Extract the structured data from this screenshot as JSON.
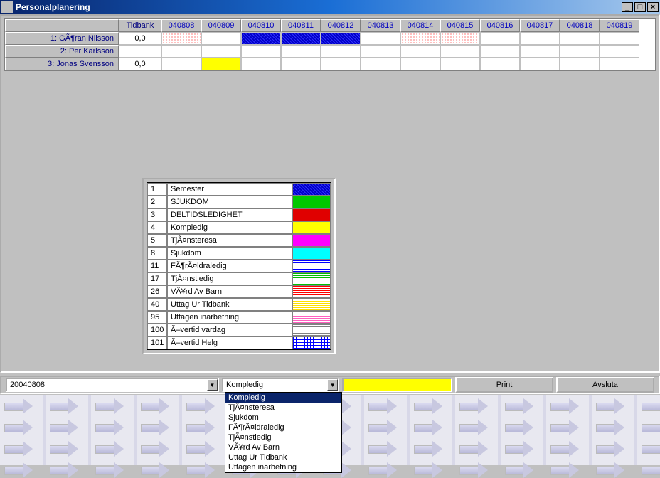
{
  "window": {
    "title": "Personalplanering"
  },
  "grid": {
    "headers": {
      "tidbank": "Tidbank",
      "dates": [
        "040808",
        "040809",
        "040810",
        "040811",
        "040812",
        "040813",
        "040814",
        "040815",
        "040816",
        "040817",
        "040818",
        "040819"
      ]
    },
    "rows": [
      {
        "name": "1: GÃ¶ran Nilsson",
        "tid": "0,0",
        "cells": [
          "pat-dotred",
          "",
          "pat-blue",
          "pat-blue",
          "pat-blue",
          "",
          "pat-dotred",
          "pat-dotred",
          "",
          "",
          "",
          ""
        ]
      },
      {
        "name": "2: Per Karlsson",
        "tid": "",
        "cells": [
          "",
          "",
          "",
          "",
          "",
          "",
          "",
          "",
          "",
          "",
          "",
          ""
        ]
      },
      {
        "name": "3: Jonas Svensson",
        "tid": "0,0",
        "cells": [
          "",
          "pat-yellow",
          "",
          "",
          "",
          "",
          "",
          "",
          "",
          "",
          "",
          ""
        ]
      }
    ]
  },
  "legend": [
    {
      "num": "1",
      "name": "Semester",
      "sw": "pat-blue"
    },
    {
      "num": "2",
      "name": "SJUKDOM",
      "sw": "pat-green"
    },
    {
      "num": "3",
      "name": "DELTIDSLEDIGHET",
      "sw": "pat-red"
    },
    {
      "num": "4",
      "name": "Kompledig",
      "sw": "pat-yellow"
    },
    {
      "num": "5",
      "name": "TjÃ¤nsteresa",
      "sw": "pat-magenta"
    },
    {
      "num": "8",
      "name": "Sjukdom",
      "sw": "pat-cyan"
    },
    {
      "num": "11",
      "name": "FÃ¶rÃ¤ldraledig",
      "sw": "pat-stripe-blue"
    },
    {
      "num": "17",
      "name": "TjÃ¤nstledig",
      "sw": "pat-stripe-green"
    },
    {
      "num": "26",
      "name": "VÃ¥rd Av Barn",
      "sw": "pat-stripe-red"
    },
    {
      "num": "40",
      "name": "Uttag Ur Tidbank",
      "sw": "pat-stripe-yellow"
    },
    {
      "num": "95",
      "name": "Uttagen inarbetning",
      "sw": "pat-stripe-pink"
    },
    {
      "num": "100",
      "name": "Ã–vertid vardag",
      "sw": "pat-stripe-gray"
    },
    {
      "num": "101",
      "name": "Ã–vertid Helg",
      "sw": "pat-grid-blue"
    }
  ],
  "bottom": {
    "date": "20040808",
    "type_selected": "Kompledig",
    "swatch": "pat-yellow",
    "print": "Print",
    "close": "Avsluta"
  },
  "dropdown": [
    {
      "label": "Kompledig",
      "selected": true
    },
    {
      "label": "TjÃ¤nsteresa"
    },
    {
      "label": "Sjukdom"
    },
    {
      "label": "FÃ¶rÃ¤ldraledig"
    },
    {
      "label": "TjÃ¤nstledig"
    },
    {
      "label": "VÃ¥rd Av Barn"
    },
    {
      "label": "Uttag Ur Tidbank"
    },
    {
      "label": "Uttagen inarbetning"
    }
  ]
}
